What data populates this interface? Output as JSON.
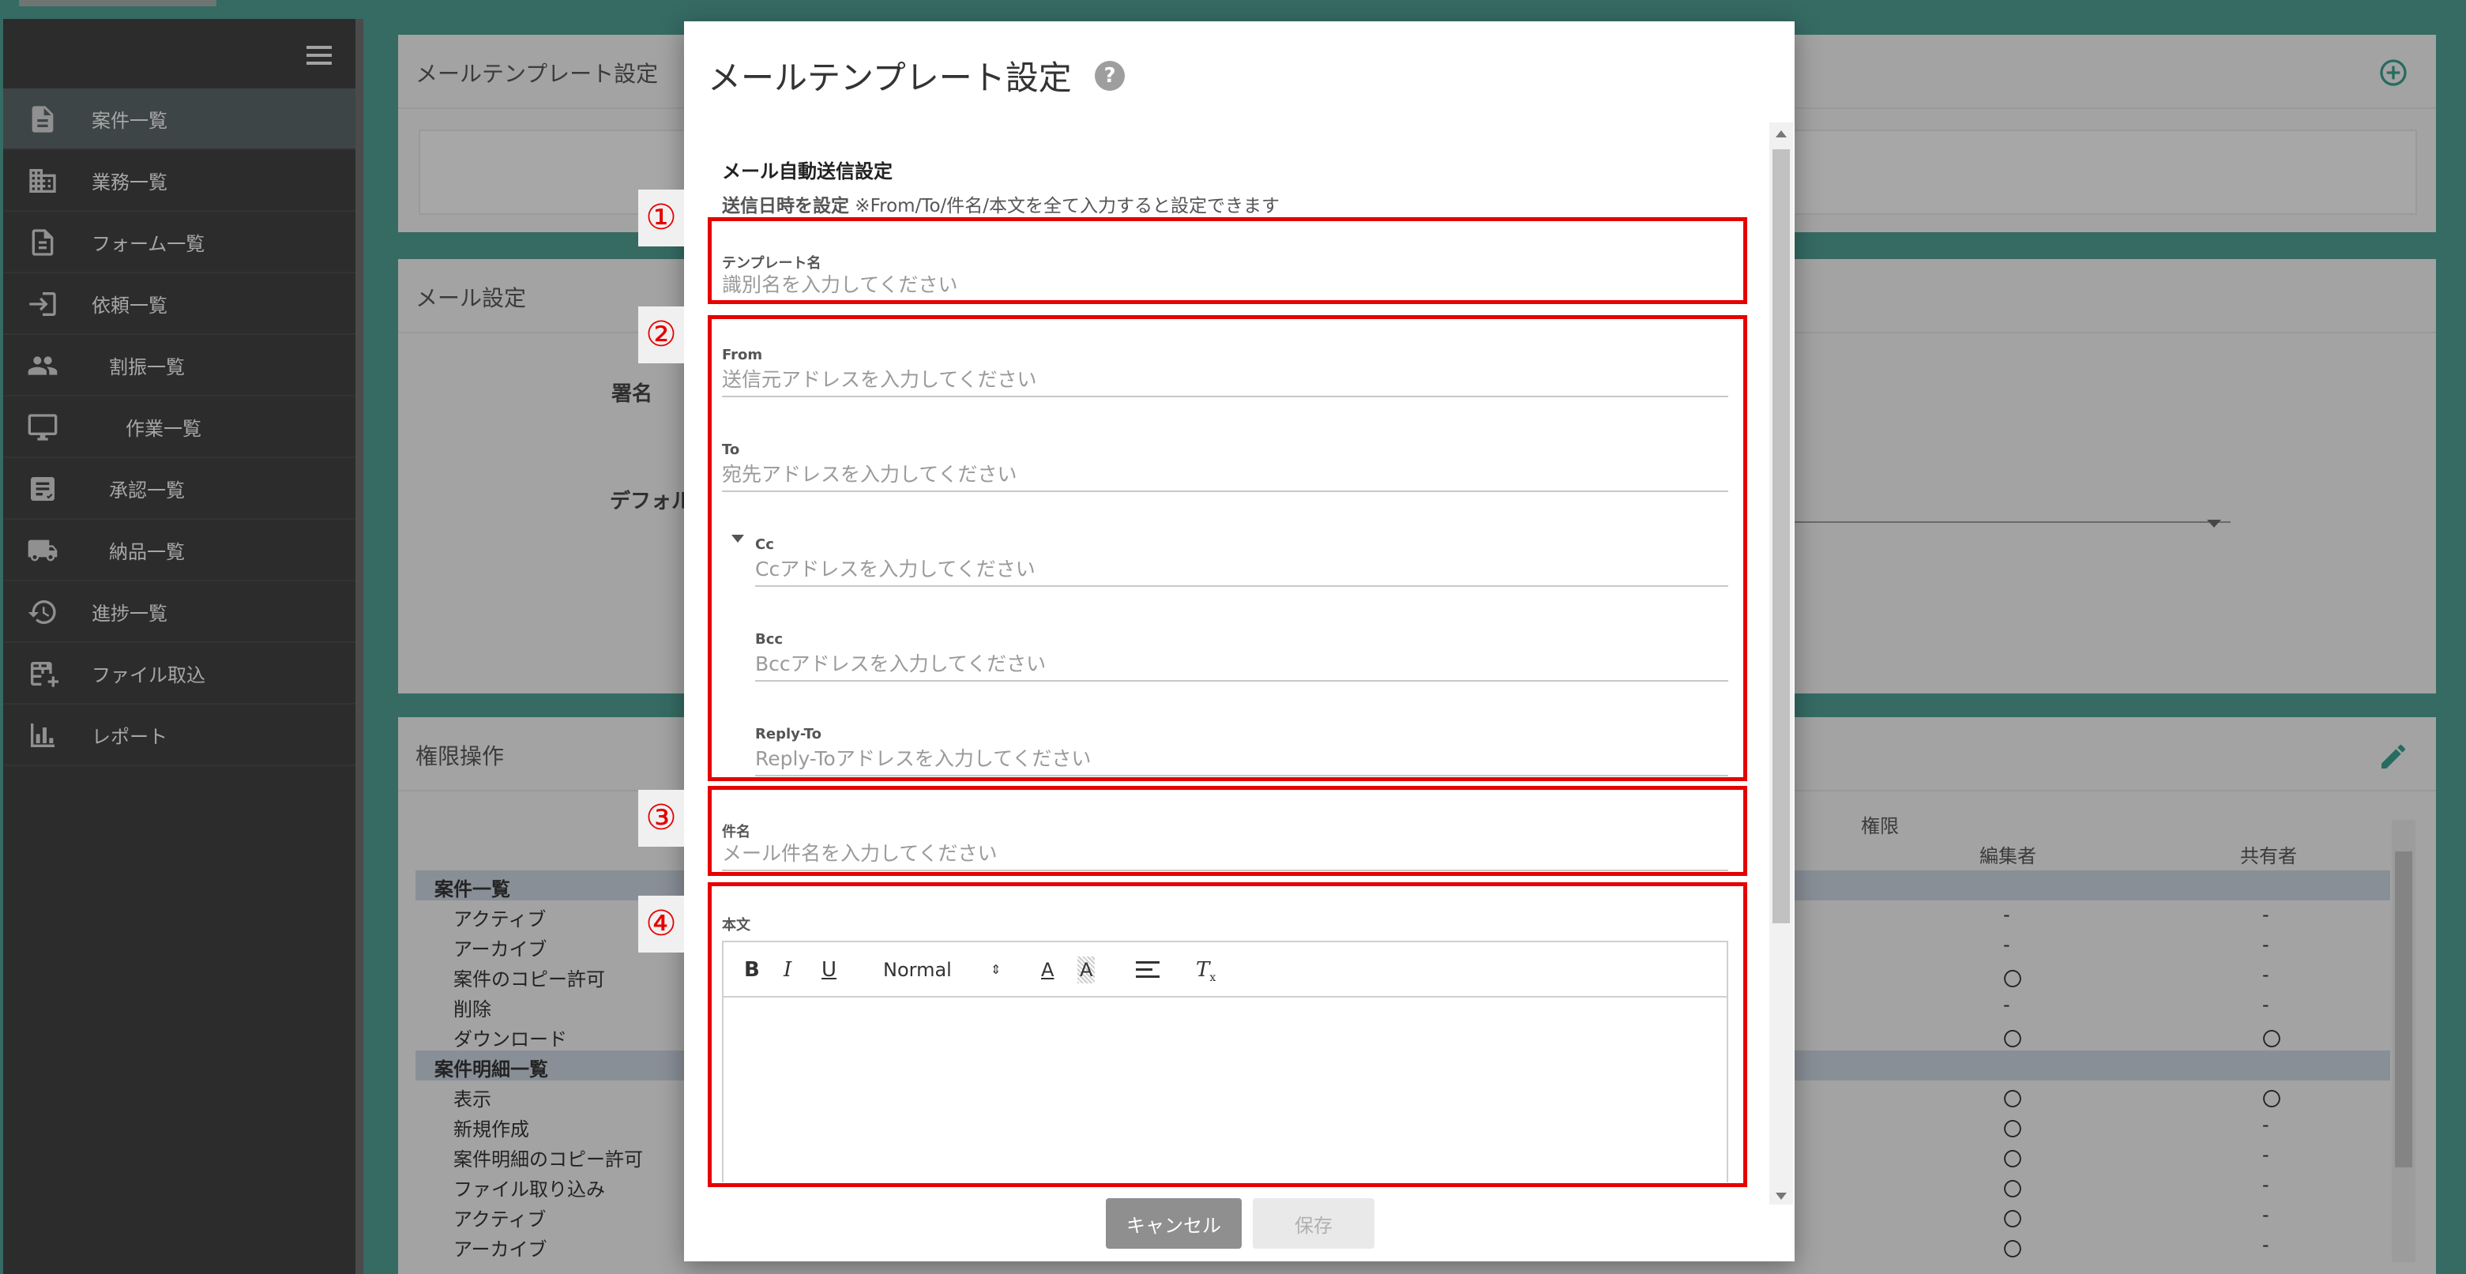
{
  "sidebar": {
    "items": [
      {
        "label": "案件一覧",
        "icon": "document-icon",
        "active": true
      },
      {
        "label": "業務一覧",
        "icon": "building-icon"
      },
      {
        "label": "フォーム一覧",
        "icon": "form-file-icon"
      },
      {
        "label": "依頼一覧",
        "icon": "login-arrow-icon"
      },
      {
        "label": "割振一覧",
        "icon": "people-icon"
      },
      {
        "label": "作業一覧",
        "icon": "monitor-icon"
      },
      {
        "label": "承認一覧",
        "icon": "approval-icon"
      },
      {
        "label": "納品一覧",
        "icon": "truck-icon"
      },
      {
        "label": "進捗一覧",
        "icon": "clock-icon"
      },
      {
        "label": "ファイル取込",
        "icon": "table-add-icon"
      },
      {
        "label": "レポート",
        "icon": "bar-chart-icon"
      }
    ]
  },
  "background": {
    "card1_title": "メールテンプレート設定",
    "card2_title": "メール設定",
    "card2_label_signature": "署名",
    "card2_label_default": "デフォル",
    "card3_title": "権限操作",
    "perm_header": "権限",
    "perm_col_editor": "編集者",
    "perm_col_sharer": "共有者",
    "perm_rows": [
      {
        "name": "案件一覧",
        "group": true,
        "c1": "",
        "c2": ""
      },
      {
        "name": "アクティブ",
        "c1": "-",
        "c2": "-"
      },
      {
        "name": "アーカイブ",
        "c1": "-",
        "c2": "-"
      },
      {
        "name": "案件のコピー許可",
        "c1": "〇",
        "c2": "-"
      },
      {
        "name": "削除",
        "c1": "-",
        "c2": "-"
      },
      {
        "name": "ダウンロード",
        "c1": "〇",
        "c2": "〇"
      },
      {
        "name": "案件明細一覧",
        "group": true,
        "c1": "",
        "c2": ""
      },
      {
        "name": "表示",
        "c1": "〇",
        "c2": "〇"
      },
      {
        "name": "新規作成",
        "c1": "〇",
        "c2": "-"
      },
      {
        "name": "案件明細のコピー許可",
        "c1": "〇",
        "c2": "-"
      },
      {
        "name": "ファイル取り込み",
        "c1": "〇",
        "c2": "-"
      },
      {
        "name": "アクティブ",
        "c1": "〇",
        "c2": "-"
      },
      {
        "name": "アーカイブ",
        "c1": "〇",
        "c2": "-"
      }
    ]
  },
  "dialog": {
    "title": "メールテンプレート設定",
    "help": "?",
    "section_title": "メール自動送信設定",
    "section_desc_bold": "送信日時を設定",
    "section_desc_rest": " ※From/To/件名/本文を全て入力すると設定できます",
    "fields": {
      "template_name": {
        "label": "テンプレート名",
        "placeholder": "識別名を入力してください",
        "value": ""
      },
      "from": {
        "label": "From",
        "placeholder": "送信元アドレスを入力してください",
        "value": ""
      },
      "to": {
        "label": "To",
        "placeholder": "宛先アドレスを入力してください",
        "value": ""
      },
      "cc": {
        "label": "Cc",
        "placeholder": "Ccアドレスを入力してください",
        "value": ""
      },
      "bcc": {
        "label": "Bcc",
        "placeholder": "Bccアドレスを入力してください",
        "value": ""
      },
      "reply_to": {
        "label": "Reply-To",
        "placeholder": "Reply-Toアドレスを入力してください",
        "value": ""
      },
      "subject": {
        "label": "件名",
        "placeholder": "メール件名を入力してください",
        "value": ""
      },
      "body": {
        "label": "本文"
      }
    },
    "editor_toolbar": {
      "bold": "B",
      "italic": "I",
      "underline": "U",
      "size": "Normal",
      "size_arrow": "⇕",
      "color": "A",
      "background": "A",
      "clear": "T"
    },
    "annotations": [
      "①",
      "②",
      "③",
      "④"
    ],
    "cancel_label": "キャンセル",
    "save_label": "保存"
  },
  "colors": {
    "background_teal": "#4d9a8f",
    "sidebar": "#3f3f3f",
    "annotation_red": "#e60000",
    "cancel_button": "#8f8f8f",
    "save_button_disabled": "#e9e9e9"
  }
}
